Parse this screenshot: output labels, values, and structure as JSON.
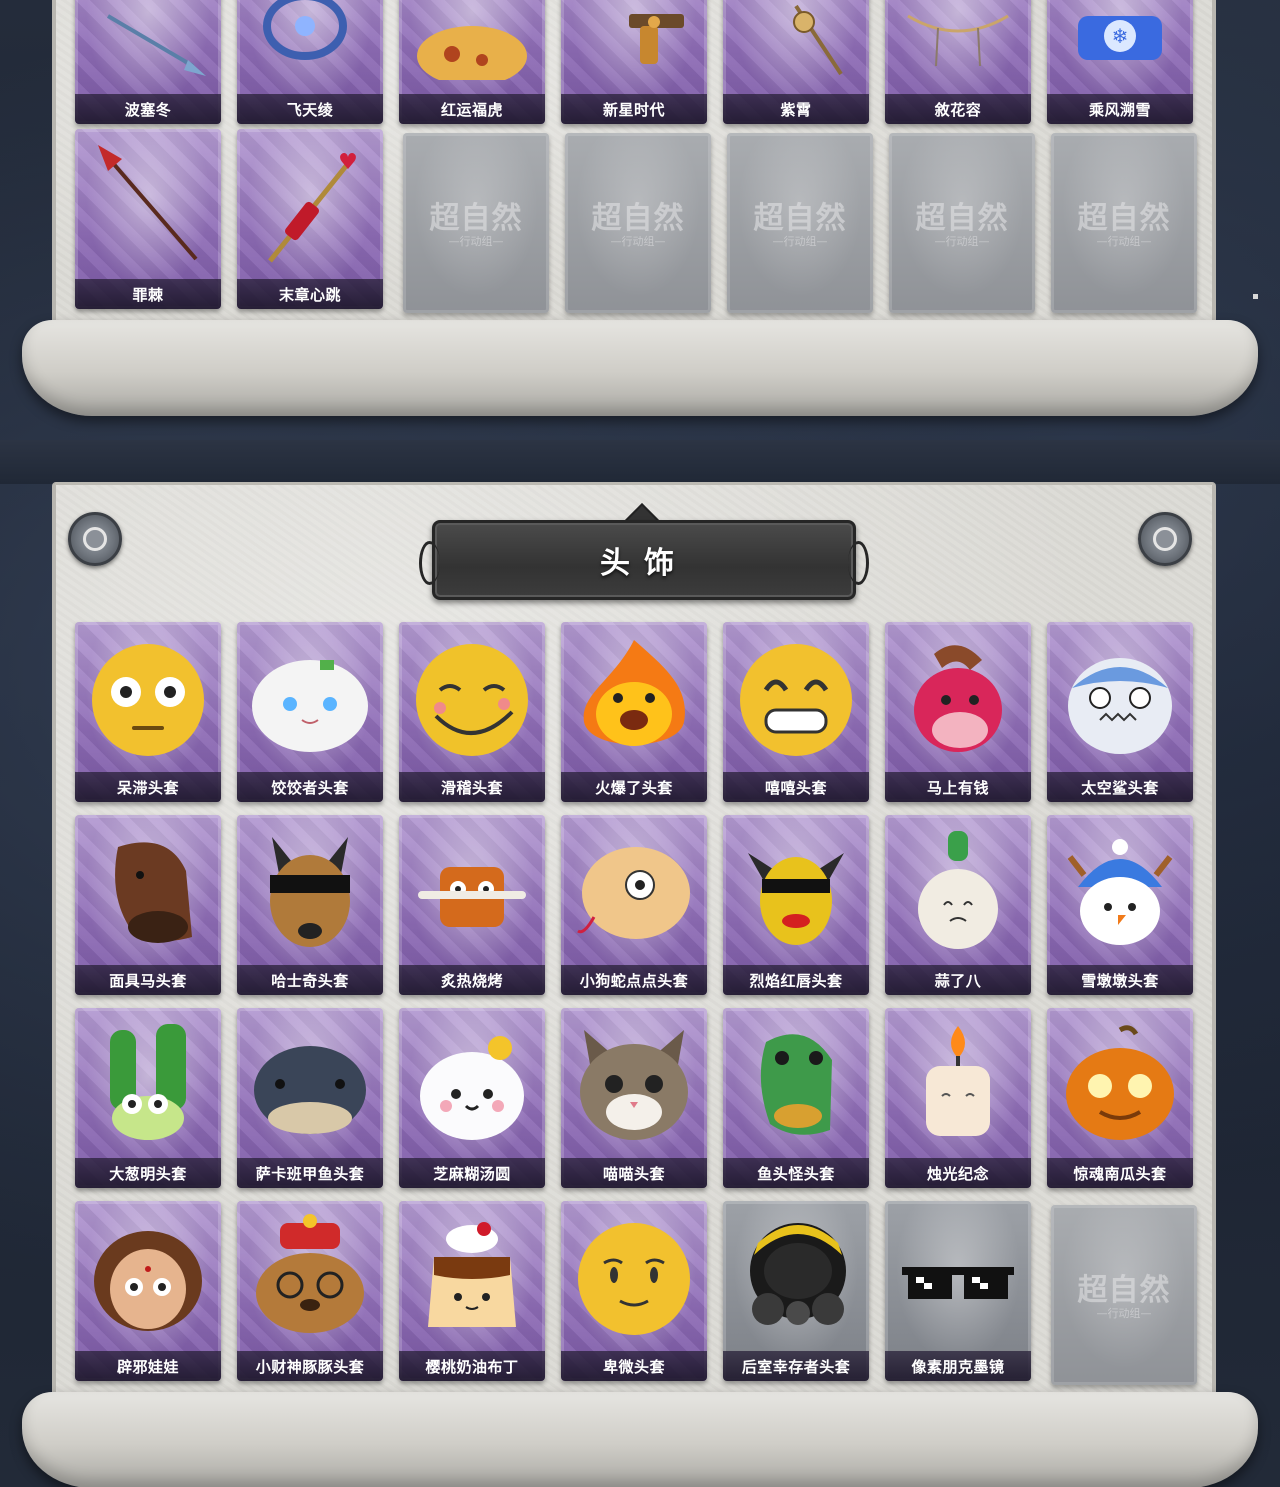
{
  "top_items": {
    "row1": [
      "波塞冬",
      "飞天绫",
      "红运福虎",
      "新星时代",
      "紫霄",
      "敘花容",
      "乘风溯雪"
    ],
    "row2": [
      "罪棘",
      "末章心跳"
    ],
    "locked_count_text": ""
  },
  "watermark": {
    "main": "超自然",
    "sub": "—行动组—"
  },
  "headwear_section": {
    "title": "头饰",
    "rows": [
      [
        "呆滞头套",
        "饺饺者头套",
        "滑稽头套",
        "火爆了头套",
        "嘻嘻头套",
        "马上有钱",
        "太空鲨头套"
      ],
      [
        "面具马头套",
        "哈士奇头套",
        "炙热烧烤",
        "小狗蛇点点头套",
        "烈焰红唇头套",
        "蒜了八",
        "雪墩墩头套"
      ],
      [
        "大葱明头套",
        "萨卡班甲鱼头套",
        "芝麻糊汤圆",
        "喵喵头套",
        "鱼头怪头套",
        "烛光纪念",
        "惊魂南瓜头套"
      ],
      [
        "辟邪娃娃",
        "小财神豚豚头套",
        "樱桃奶油布丁",
        "卑微头套",
        "后室幸存者头套",
        "像素朋克墨镜"
      ]
    ]
  },
  "colors": {
    "card_purple": "#8e6cb6",
    "card_empty_grey": "#9b9ea3",
    "scroll_paper": "#dcdbd6",
    "banner_dark": "#3b3b3b",
    "label_text": "#ffffff"
  }
}
